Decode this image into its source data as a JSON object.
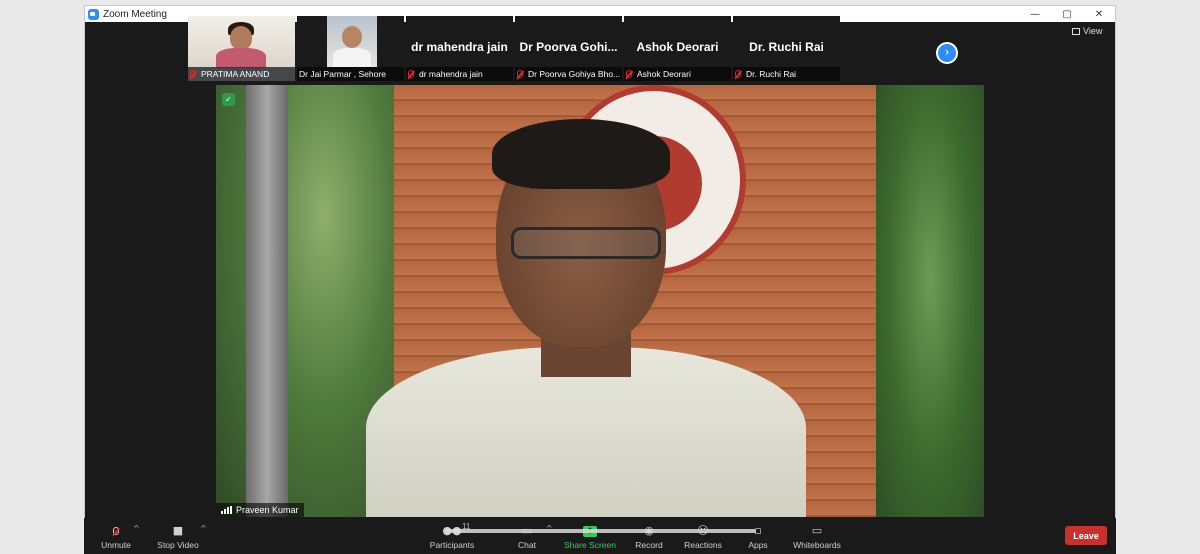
{
  "window": {
    "title": "Zoom Meeting",
    "controls": [
      "—",
      "▢",
      "✕"
    ]
  },
  "view_button": {
    "label": "View"
  },
  "participants_strip": [
    {
      "name": "PRATIMA ANAND",
      "video": true,
      "muted": true
    },
    {
      "name": "Dr Jai Parmar , Sehore",
      "video": true,
      "muted": false
    },
    {
      "display": "dr mahendra jain",
      "name": "dr mahendra jain",
      "video": false,
      "muted": true
    },
    {
      "display": "Dr Poorva Gohi...",
      "name": "Dr Poorva Gohiya Bho...",
      "video": false,
      "muted": true
    },
    {
      "display": "Ashok Deorari",
      "name": "Ashok Deorari",
      "video": false,
      "muted": true
    },
    {
      "display": "Dr. Ruchi Rai",
      "name": "Dr. Ruchi Rai",
      "video": false,
      "muted": true
    }
  ],
  "active_speaker": {
    "name": "Praveen Kumar"
  },
  "toolbar": {
    "unmute": "Unmute",
    "stop_video": "Stop Video",
    "participants": "Participants",
    "participants_count": "11",
    "chat": "Chat",
    "share_screen": "Share Screen",
    "record": "Record",
    "reactions": "Reactions",
    "apps": "Apps",
    "whiteboards": "Whiteboards",
    "leave": "Leave"
  },
  "colors": {
    "accent": "#2d8cff",
    "share_green": "#2fce5c",
    "leave_red": "#c8302c",
    "mute_red": "#e02828"
  }
}
